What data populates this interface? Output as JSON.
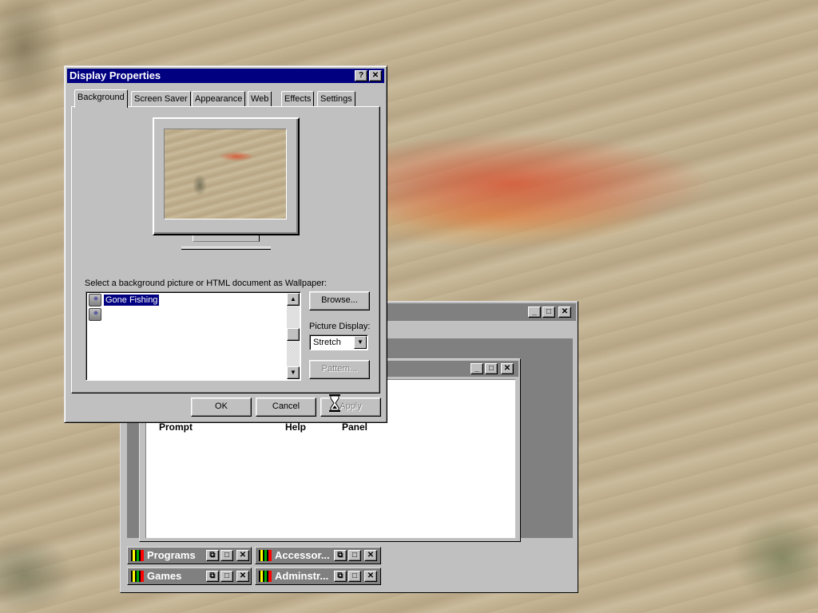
{
  "desktop": {
    "wallpaper": "Gone Fishing"
  },
  "back_window": {
    "controls": [
      "_",
      "□",
      "✕"
    ],
    "inner_window": {
      "controls": [
        "_",
        "□",
        "✕"
      ],
      "icon_labels": [
        "Prompt",
        "Help",
        "Panel"
      ]
    },
    "minimized_groups": [
      {
        "label": "Programs"
      },
      {
        "label": "Accessor..."
      },
      {
        "label": "Games"
      },
      {
        "label": "Adminstr..."
      }
    ]
  },
  "dialog": {
    "title": "Display Properties",
    "help_button": "?",
    "close_button": "✕",
    "tabs": [
      {
        "label": "Background",
        "active": true
      },
      {
        "label": "Screen Saver"
      },
      {
        "label": "Appearance"
      },
      {
        "label": "Web"
      },
      {
        "label": "Effects"
      },
      {
        "label": "Settings"
      }
    ],
    "wallpaper_prompt": "Select a background picture or HTML document as Wallpaper:",
    "wallpaper_list": [
      {
        "label": "Gone Fishing",
        "selected": true
      },
      {
        "label": ""
      }
    ],
    "browse_button": "Browse...",
    "picture_display_label": "Picture Display:",
    "picture_display_value": "Stretch",
    "pattern_button": "Pattern...",
    "ok_button": "OK",
    "cancel_button": "Cancel",
    "apply_button": "Apply"
  },
  "colors": {
    "titlebar_active": "#000080",
    "titlebar_inactive": "#808080",
    "face": "#c0c0c0",
    "selection": "#000080"
  }
}
